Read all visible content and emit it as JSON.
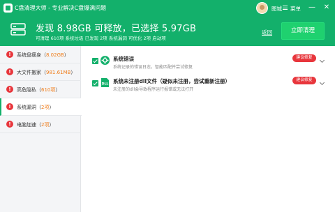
{
  "window": {
    "title": "C盘清理大师 - 专业解决C盘爆满问题",
    "username": "图城",
    "menu_label": "菜单",
    "minimize": "—",
    "close": "✕"
  },
  "summary": {
    "headline": "发现 8.98GB 可释放，已选择 5.97GB",
    "subline": "可清理 610项 系统垃圾    已发现 2项 系统漏洞    可优化 2项 启动项",
    "back_label": "返回",
    "clean_button": "立即清理"
  },
  "sidebar": {
    "items": [
      {
        "name": "系统盘瘦身",
        "open": "（",
        "value": "8.02GB",
        "close": "）"
      },
      {
        "name": "大文件搬家",
        "open": "（",
        "value": "981.61MB",
        "close": "）"
      },
      {
        "name": "高危隐私",
        "open": "（",
        "value": "610项",
        "close": "）"
      },
      {
        "name": "系统漏洞",
        "open": "（",
        "value": "2项",
        "close": "）"
      },
      {
        "name": "电脑加速",
        "open": "（",
        "value": "2项",
        "close": "）"
      }
    ],
    "active_index": 3
  },
  "issues": [
    {
      "title": "系统错误",
      "desc": "系统记录的错误日志，智能匹配并尝试修复",
      "badge": "建议修复",
      "icon": "gear-icon"
    },
    {
      "title": "系统未注册dll文件（疑似未注册，尝试重新注册）",
      "desc": "未注册的dll会导致程序运行报错或无法打开",
      "badge": "建议修复",
      "icon": "dll-icon",
      "icon_text": "DLL"
    }
  ],
  "colors": {
    "brand_green": "#13b06b",
    "alert_red": "#e8363c",
    "value_orange": "#f07d1b"
  }
}
